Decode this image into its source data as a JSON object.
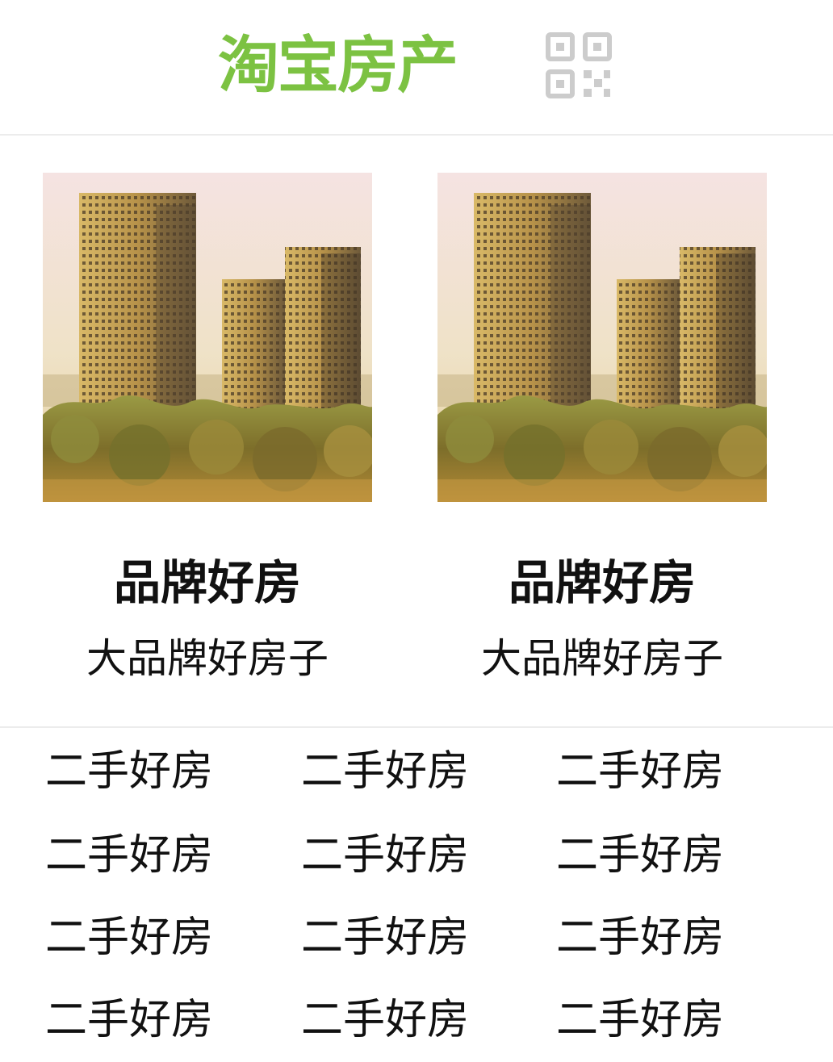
{
  "header": {
    "logo_text": "淘宝房产",
    "logo_color": "#7cc242",
    "qr_icon": "qr-code-icon",
    "qr_color": "#cccccc"
  },
  "featured": [
    {
      "title": "品牌好房",
      "subtitle": "大品牌好房子"
    },
    {
      "title": "品牌好房",
      "subtitle": "大品牌好房子"
    }
  ],
  "links": [
    [
      "二手好房",
      "二手好房",
      "二手好房"
    ],
    [
      "二手好房",
      "二手好房",
      "二手好房"
    ],
    [
      "二手好房",
      "二手好房",
      "二手好房"
    ],
    [
      "二手好房",
      "二手好房",
      "二手好房"
    ]
  ]
}
